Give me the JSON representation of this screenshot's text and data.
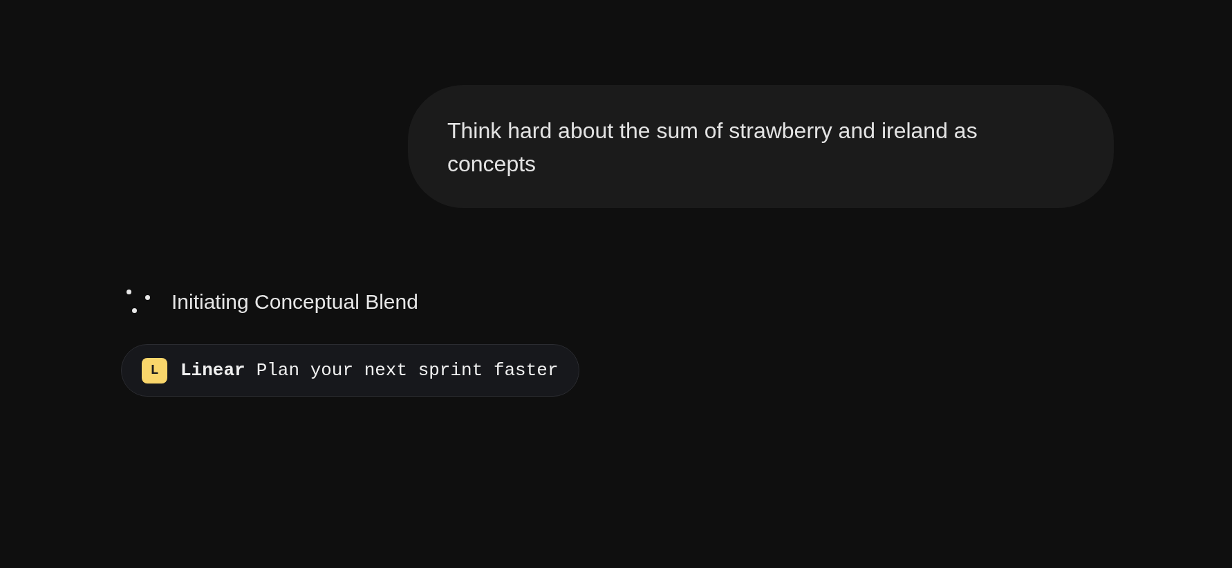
{
  "user_message": {
    "text": "Think hard about the sum of strawberry and ireland as concepts"
  },
  "status": {
    "text": "Initiating Conceptual Blend"
  },
  "sponsor_chip": {
    "logo_letter": "L",
    "brand": "Linear",
    "tagline": "Plan your next sprint faster"
  }
}
